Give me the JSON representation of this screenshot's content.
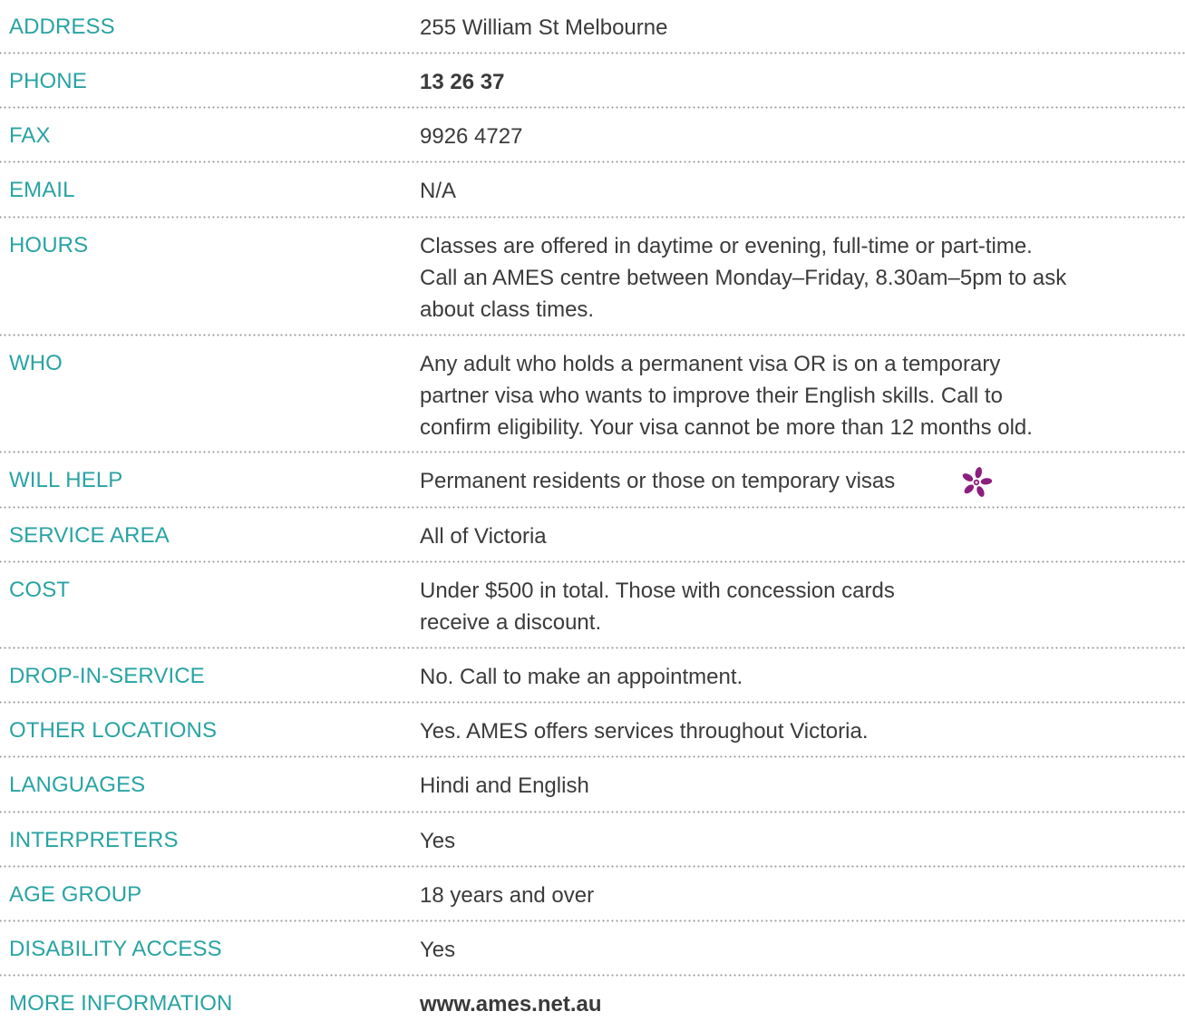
{
  "rows": [
    {
      "label": "ADDRESS",
      "value": "255 William St Melbourne"
    },
    {
      "label": "PHONE",
      "value": "13 26 37"
    },
    {
      "label": "FAX",
      "value": "9926 4727"
    },
    {
      "label": "EMAIL",
      "value": "N/A"
    },
    {
      "label": "HOURS",
      "value_lines": [
        "Classes are offered in daytime or evening, full-time or part-time.",
        "Call an AMES centre between Monday–Friday, 8.30am–5pm to ask",
        "about class times."
      ]
    },
    {
      "label": "WHO",
      "value_lines": [
        "Any adult who holds a permanent visa OR is on a temporary",
        "partner visa who wants to improve their English skills. Call to",
        "confirm eligibility. Your visa cannot be more than 12 months old."
      ]
    },
    {
      "label": "WILL HELP",
      "value": "Permanent residents or those on temporary visas",
      "icon": "flower-icon",
      "icon_color": "#8b1e7e"
    },
    {
      "label": "SERVICE AREA",
      "value": "All of Victoria"
    },
    {
      "label": "COST",
      "value_lines": [
        "Under $500 in total. Those with concession cards",
        "receive a discount."
      ]
    },
    {
      "label": "DROP-IN-SERVICE",
      "value": "No. Call to make an appointment."
    },
    {
      "label": "OTHER LOCATIONS",
      "value": "Yes. AMES offers services throughout Victoria."
    },
    {
      "label": "LANGUAGES",
      "value": "Hindi and English"
    },
    {
      "label": "INTERPRETERS",
      "value": "Yes"
    },
    {
      "label": "AGE GROUP",
      "value": "18 years and over"
    },
    {
      "label": "DISABILITY ACCESS",
      "value": "Yes"
    },
    {
      "label": "MORE INFORMATION",
      "value": "www.ames.net.au"
    }
  ],
  "colors": {
    "label": "#2aa3a3",
    "value": "#3b3b3b",
    "accent": "#8b1e7e",
    "divider": "#9a9a9a"
  }
}
